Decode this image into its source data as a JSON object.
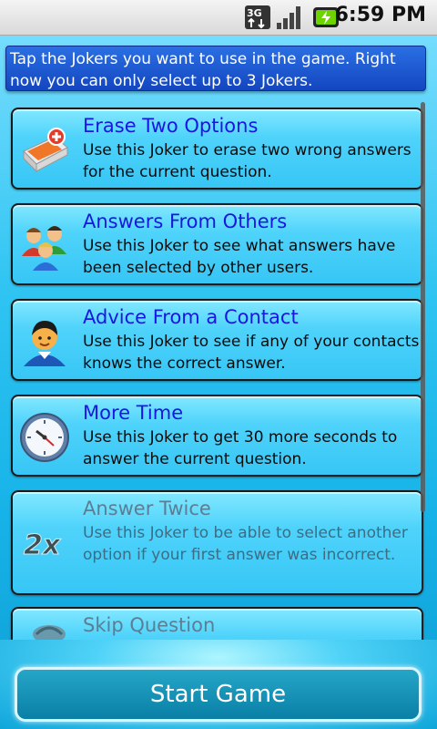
{
  "status_bar": {
    "network": "3G",
    "time": "6:59 PM"
  },
  "intro_text": "Tap the Jokers you want to use in the game. Right now you can only select up to 3 Jokers.",
  "jokers": [
    {
      "title": "Erase Two Options",
      "description": "Use this Joker to erase two wrong answers for the current question.",
      "icon": "eraser-delete-icon",
      "enabled": true
    },
    {
      "title": "Answers From Others",
      "description": "Use this Joker to see what answers have been selected by other users.",
      "icon": "people-group-icon",
      "enabled": true
    },
    {
      "title": "Advice From a Contact",
      "description": "Use this Joker to see if any of your contacts knows the correct answer.",
      "icon": "contact-person-icon",
      "enabled": true
    },
    {
      "title": "More Time",
      "description": "Use this Joker to get 30 more seconds to answer the current question.",
      "icon": "clock-icon",
      "enabled": true
    },
    {
      "title": "Answer Twice",
      "description": "Use this Joker to be able to select another option if your first answer was incorrect.",
      "icon": "two-x-icon",
      "icon_text": "2x",
      "enabled": false
    },
    {
      "title": "Skip Question",
      "description": "",
      "icon": "skip-icon",
      "enabled": false
    }
  ],
  "start_button_label": "Start Game",
  "colors": {
    "title_enabled": "#1717e0",
    "title_disabled": "#5b7e94",
    "intro_bg": "#1f5bd4",
    "card_bg": "#4fd3fb"
  }
}
